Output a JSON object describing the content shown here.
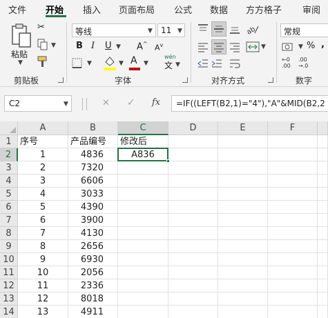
{
  "tabs": [
    "文件",
    "开始",
    "插入",
    "页面布局",
    "公式",
    "数据",
    "方方格子",
    "审阅"
  ],
  "clipboard": {
    "paste_label": "粘贴",
    "group_label": "剪贴板"
  },
  "font": {
    "name": "等线",
    "size": "11",
    "bold": "B",
    "italic": "I",
    "underline": "U",
    "grow": "A",
    "shrink": "A",
    "font_color_letter": "A",
    "wen_label": "wén",
    "wen_char": "文",
    "group_label": "字体"
  },
  "alignment": {
    "group_label": "对齐方式"
  },
  "number": {
    "format": "常规",
    "group_label": "数字",
    "percent": "%",
    "comma": ",",
    "inc_decimal_top": "←0",
    "inc_decimal_bottom": ".00",
    "dec_decimal_top": ".00",
    "dec_decimal_bottom": "→.0"
  },
  "colors": {
    "accent": "#217346",
    "highlight": "#ffff00",
    "font_color": "#c00000"
  },
  "formula_bar": {
    "name_box": "C2",
    "fx_label": "fx",
    "cancel": "✕",
    "confirm": "✓",
    "formula": "=IF((LEFT(B2,1)=\"4\"),\"A\"&MID(B2,2"
  },
  "sheet": {
    "columns": [
      "A",
      "B",
      "C",
      "D",
      "E",
      "F"
    ],
    "selected_cell": "C2",
    "rows": [
      {
        "num": "1",
        "a": "序号",
        "b": "产品编号",
        "c": "修改后"
      },
      {
        "num": "2",
        "a": "1",
        "b": "4836",
        "c": "A836"
      },
      {
        "num": "3",
        "a": "2",
        "b": "7320",
        "c": ""
      },
      {
        "num": "4",
        "a": "3",
        "b": "6606",
        "c": ""
      },
      {
        "num": "5",
        "a": "4",
        "b": "3033",
        "c": ""
      },
      {
        "num": "6",
        "a": "5",
        "b": "4390",
        "c": ""
      },
      {
        "num": "7",
        "a": "6",
        "b": "3900",
        "c": ""
      },
      {
        "num": "8",
        "a": "7",
        "b": "4130",
        "c": ""
      },
      {
        "num": "9",
        "a": "8",
        "b": "2656",
        "c": ""
      },
      {
        "num": "10",
        "a": "9",
        "b": "6930",
        "c": ""
      },
      {
        "num": "11",
        "a": "10",
        "b": "2056",
        "c": ""
      },
      {
        "num": "12",
        "a": "11",
        "b": "2336",
        "c": ""
      },
      {
        "num": "13",
        "a": "12",
        "b": "8018",
        "c": ""
      },
      {
        "num": "14",
        "a": "13",
        "b": "4911",
        "c": ""
      }
    ]
  }
}
